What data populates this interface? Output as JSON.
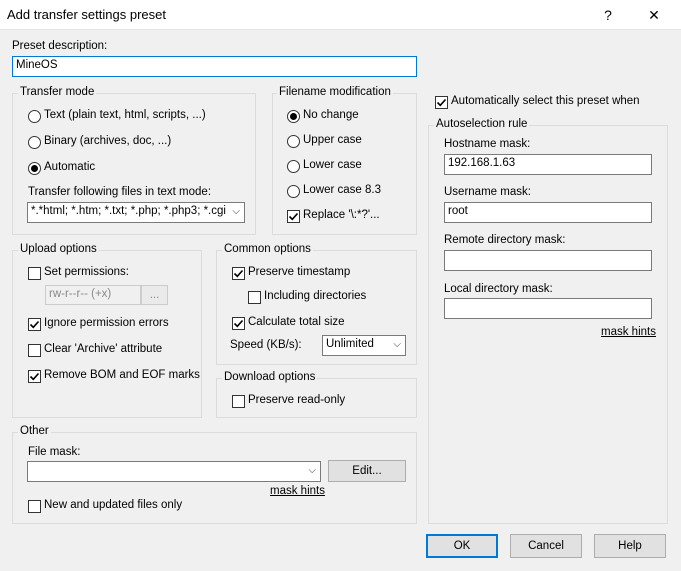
{
  "window": {
    "title": "Add transfer settings preset",
    "help_glyph": "?",
    "close_glyph": "✕"
  },
  "preset": {
    "label": "Preset description:",
    "value": "MineOS"
  },
  "transfer_mode": {
    "title": "Transfer mode",
    "text_option": "Text (plain text, html, scripts, ...)",
    "binary_option": "Binary (archives, doc, ...)",
    "automatic_option": "Automatic",
    "selected": "automatic",
    "files_label": "Transfer following files in text mode:",
    "files_value": "*.*html; *.htm; *.txt; *.php; *.php3; *.cgi"
  },
  "filename_mod": {
    "title": "Filename modification",
    "no_change": "No change",
    "upper_case": "Upper case",
    "lower_case": "Lower case",
    "lower_case_83": "Lower case 8.3",
    "replace": "Replace '\\:*?'..."
  },
  "upload": {
    "title": "Upload options",
    "set_permissions": "Set permissions:",
    "permissions_value": "rw-r--r-- (+x)",
    "perm_button": "...",
    "ignore_errors": "Ignore permission errors",
    "clear_archive": "Clear 'Archive' attribute",
    "remove_bom": "Remove BOM and EOF marks"
  },
  "common": {
    "title": "Common options",
    "preserve_timestamp": "Preserve timestamp",
    "including_dirs": "Including directories",
    "calc_total": "Calculate total size",
    "speed_label": "Speed (KB/s):",
    "speed_value": "Unlimited"
  },
  "download": {
    "title": "Download options",
    "preserve_readonly": "Preserve read-only"
  },
  "other": {
    "title": "Other",
    "file_mask_label": "File mask:",
    "file_mask_value": "",
    "edit_button": "Edit...",
    "mask_hints": "mask hints",
    "new_updated": "New and updated files only"
  },
  "autoselect": {
    "auto_label": "Automatically select this preset when",
    "title": "Autoselection rule",
    "hostname_label": "Hostname mask:",
    "hostname_value": "192.168.1.63",
    "username_label": "Username mask:",
    "username_value": "root",
    "remote_dir_label": "Remote directory mask:",
    "remote_dir_value": "",
    "local_dir_label": "Local directory mask:",
    "local_dir_value": "",
    "mask_hints": "mask hints"
  },
  "buttons": {
    "ok": "OK",
    "cancel": "Cancel",
    "help": "Help"
  },
  "colors": {
    "accent": "#0078d7",
    "background": "#f0f0f0"
  }
}
